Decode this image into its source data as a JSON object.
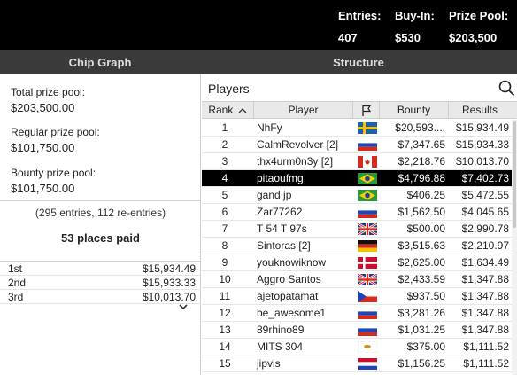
{
  "header": {
    "entries_label": "Entries:",
    "entries_value": "407",
    "buyin_label": "Buy-In:",
    "buyin_value": "$530",
    "prize_label": "Prize Pool:",
    "prize_value": "$203,500"
  },
  "tabs": [
    {
      "label": "Chip Graph"
    },
    {
      "label": "Structure"
    }
  ],
  "prize_info": {
    "total_label": "Total prize pool:",
    "total_value": "$203,500.00",
    "regular_label": "Regular prize pool:",
    "regular_value": "$101,750.00",
    "bounty_label": "Bounty prize pool:",
    "bounty_value": "$101,750.00",
    "entries_note": "(295 entries, 112 re-entries)",
    "places_paid": "53 places paid"
  },
  "payouts": [
    {
      "place": "1st",
      "amount": "$15,934.49"
    },
    {
      "place": "2nd",
      "amount": "$15,933.33"
    },
    {
      "place": "3rd",
      "amount": "$10,013.70"
    }
  ],
  "players_panel": {
    "title": "Players",
    "columns": {
      "rank": "Rank",
      "player": "Player",
      "bounty": "Bounty",
      "results": "Results"
    },
    "rows": [
      {
        "rank": "1",
        "player": "NhFy",
        "flag": "SE",
        "bounty": "$20,593....",
        "results": "$15,934.49"
      },
      {
        "rank": "2",
        "player": "CalmRevolver [2]",
        "flag": "RU",
        "bounty": "$7,347.65",
        "results": "$15,934.33"
      },
      {
        "rank": "3",
        "player": "thx4urm0n3y [2]",
        "flag": "CA",
        "bounty": "$2,218.76",
        "results": "$10,013.70"
      },
      {
        "rank": "4",
        "player": "pitaoufmg",
        "flag": "BR",
        "bounty": "$4,796.88",
        "results": "$7,402.73",
        "selected": true
      },
      {
        "rank": "5",
        "player": "gand jp",
        "flag": "BR",
        "bounty": "$406.25",
        "results": "$5,472.55"
      },
      {
        "rank": "6",
        "player": "Zar77262",
        "flag": "RU",
        "bounty": "$1,562.50",
        "results": "$4,045.65"
      },
      {
        "rank": "7",
        "player": "T 54 T 97s",
        "flag": "GB",
        "bounty": "$500.00",
        "results": "$2,990.78"
      },
      {
        "rank": "8",
        "player": "Sintoras [2]",
        "flag": "DE",
        "bounty": "$3,515.63",
        "results": "$2,210.97"
      },
      {
        "rank": "9",
        "player": "youknowiknow",
        "flag": "DK",
        "bounty": "$2,625.00",
        "results": "$1,634.49"
      },
      {
        "rank": "10",
        "player": "Aggro Santos",
        "flag": "GB",
        "bounty": "$2,433.59",
        "results": "$1,347.88"
      },
      {
        "rank": "11",
        "player": "ajetopatamat",
        "flag": "CZ",
        "bounty": "$937.50",
        "results": "$1,347.88"
      },
      {
        "rank": "12",
        "player": "be_awesome1",
        "flag": "RU",
        "bounty": "$3,281.26",
        "results": "$1,347.88"
      },
      {
        "rank": "13",
        "player": "89rhino89",
        "flag": "RU",
        "bounty": "$1,031.25",
        "results": "$1,347.88"
      },
      {
        "rank": "14",
        "player": "MITS 304",
        "flag": "CY",
        "bounty": "$375.00",
        "results": "$1,111.52"
      },
      {
        "rank": "15",
        "player": "jipvis",
        "flag": "NL",
        "bounty": "$1,156.25",
        "results": "$1,111.52"
      }
    ]
  },
  "icons": {
    "search": "search-icon",
    "flag_column": "flag-icon",
    "sort": "sort-up-icon",
    "expand": "chevron-down-icon"
  },
  "colors": {
    "header_bg": "#000000",
    "tab_bg": "#3a3a3a",
    "selected_row": "#000000",
    "table_head_bg": "#e9e9e9"
  }
}
